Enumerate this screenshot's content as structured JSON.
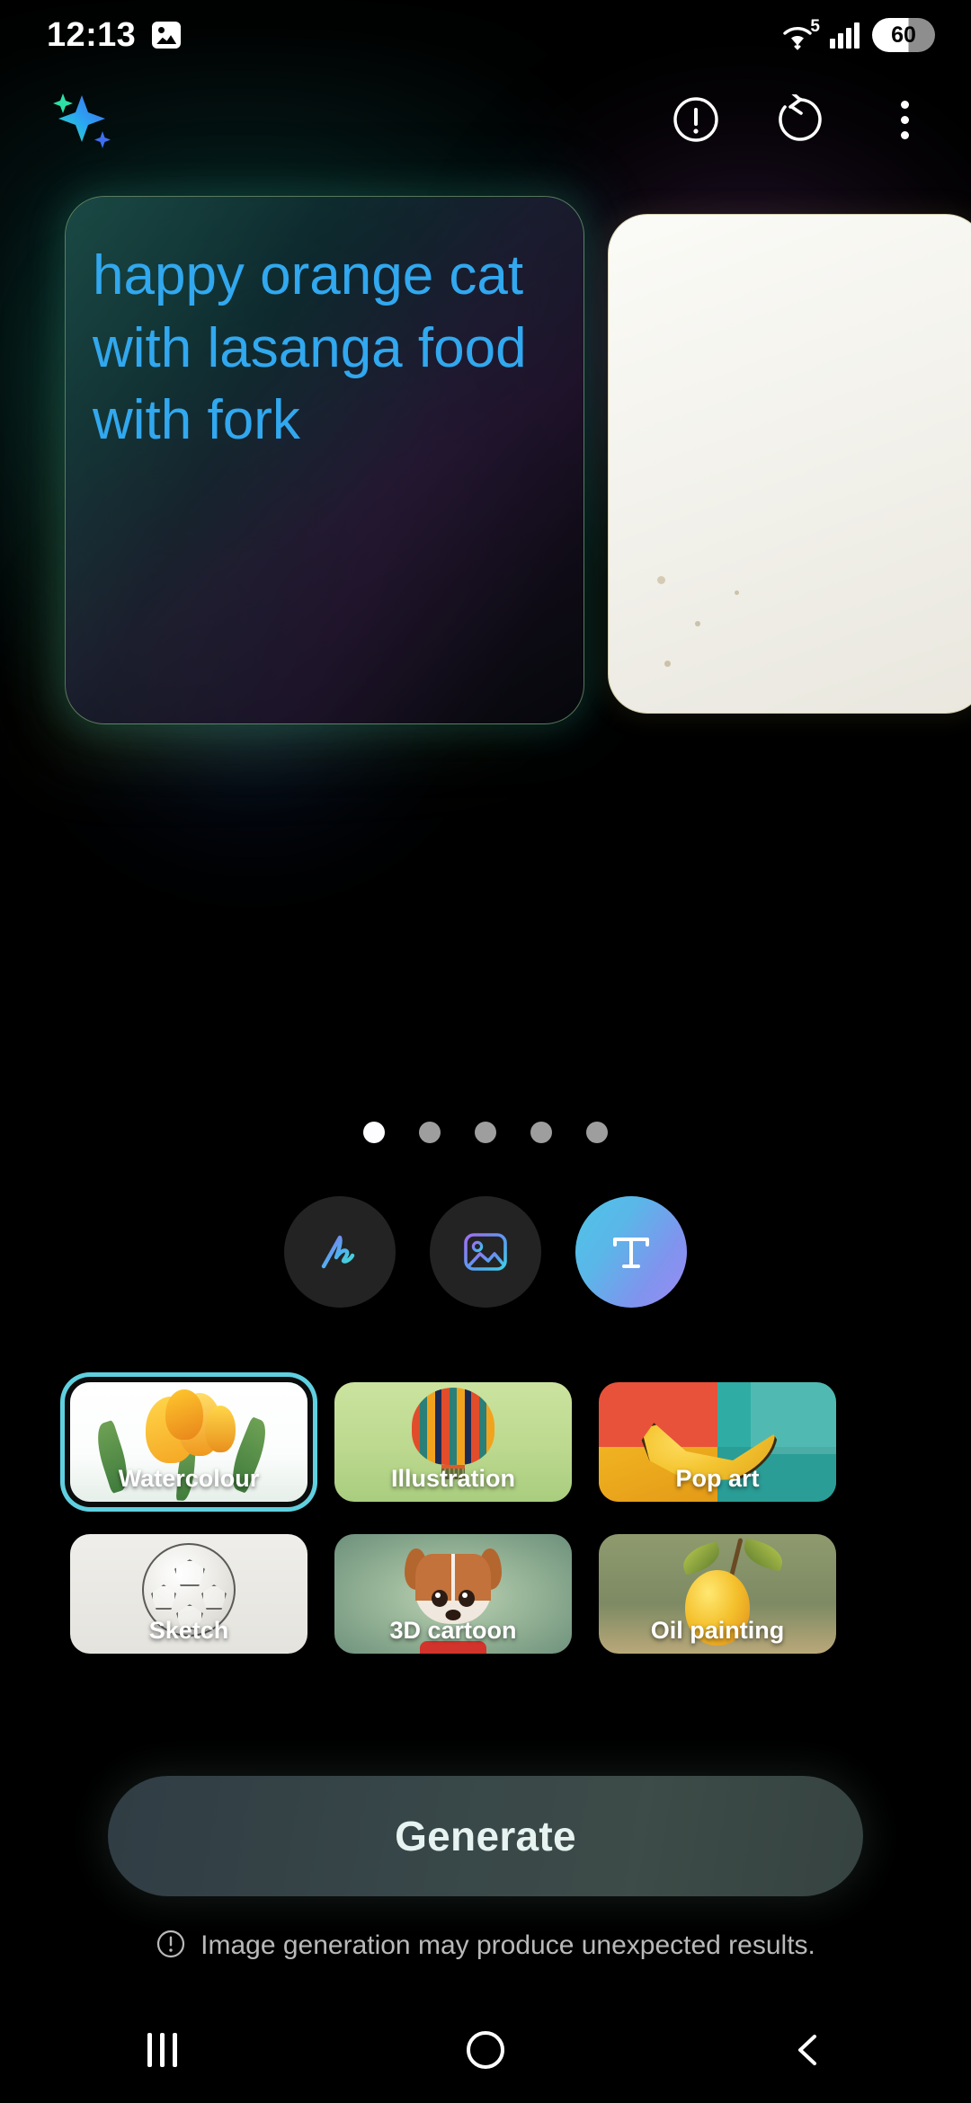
{
  "status_bar": {
    "time": "12:13",
    "left_icons": [
      {
        "name": "image-icon"
      }
    ],
    "wifi": {
      "icon": "wifi-icon",
      "superscript": "5"
    },
    "signal": {
      "icon": "cellular-signal-icon",
      "bars": 4
    },
    "battery": {
      "level": "60"
    }
  },
  "toolbar": {
    "ai_icon": "ai-sparkle-icon",
    "actions": [
      {
        "name": "info-icon",
        "label": "Info"
      },
      {
        "name": "reset-icon",
        "label": "Reset"
      },
      {
        "name": "more-options-icon",
        "label": "More options"
      }
    ]
  },
  "carousel": {
    "prompt_text": "happy orange cat with lasanga food with fork",
    "prompt_color": "#31a8ef",
    "card_border_color": "#96d296",
    "page_count": 5,
    "active_page": 1
  },
  "modes": [
    {
      "name": "sketch-mode",
      "icon": "scribble-icon",
      "label": "Sketch",
      "active": false
    },
    {
      "name": "image-mode",
      "icon": "image-icon",
      "label": "Image",
      "active": false
    },
    {
      "name": "text-mode",
      "icon": "text-t-icon",
      "label": "Text",
      "active": true
    }
  ],
  "styles": {
    "selected": "Watercolour",
    "selected_ring_color": "#5fd0e0",
    "items": [
      {
        "label": "Watercolour",
        "art": "tulip",
        "selected": true
      },
      {
        "label": "Illustration",
        "art": "hot-air-balloon",
        "selected": false
      },
      {
        "label": "Pop art",
        "art": "banana",
        "selected": false
      },
      {
        "label": "Sketch",
        "art": "football",
        "selected": false
      },
      {
        "label": "3D cartoon",
        "art": "puppy",
        "selected": false
      },
      {
        "label": "Oil painting",
        "art": "lemon",
        "selected": false
      }
    ]
  },
  "generate": {
    "label": "Generate"
  },
  "disclaimer": {
    "icon": "warning-circle-icon",
    "text": "Image generation may produce unexpected results."
  },
  "navbar": {
    "items": [
      {
        "name": "recents-button",
        "label": "Recents"
      },
      {
        "name": "home-button",
        "label": "Home"
      },
      {
        "name": "back-button",
        "label": "Back"
      }
    ]
  }
}
